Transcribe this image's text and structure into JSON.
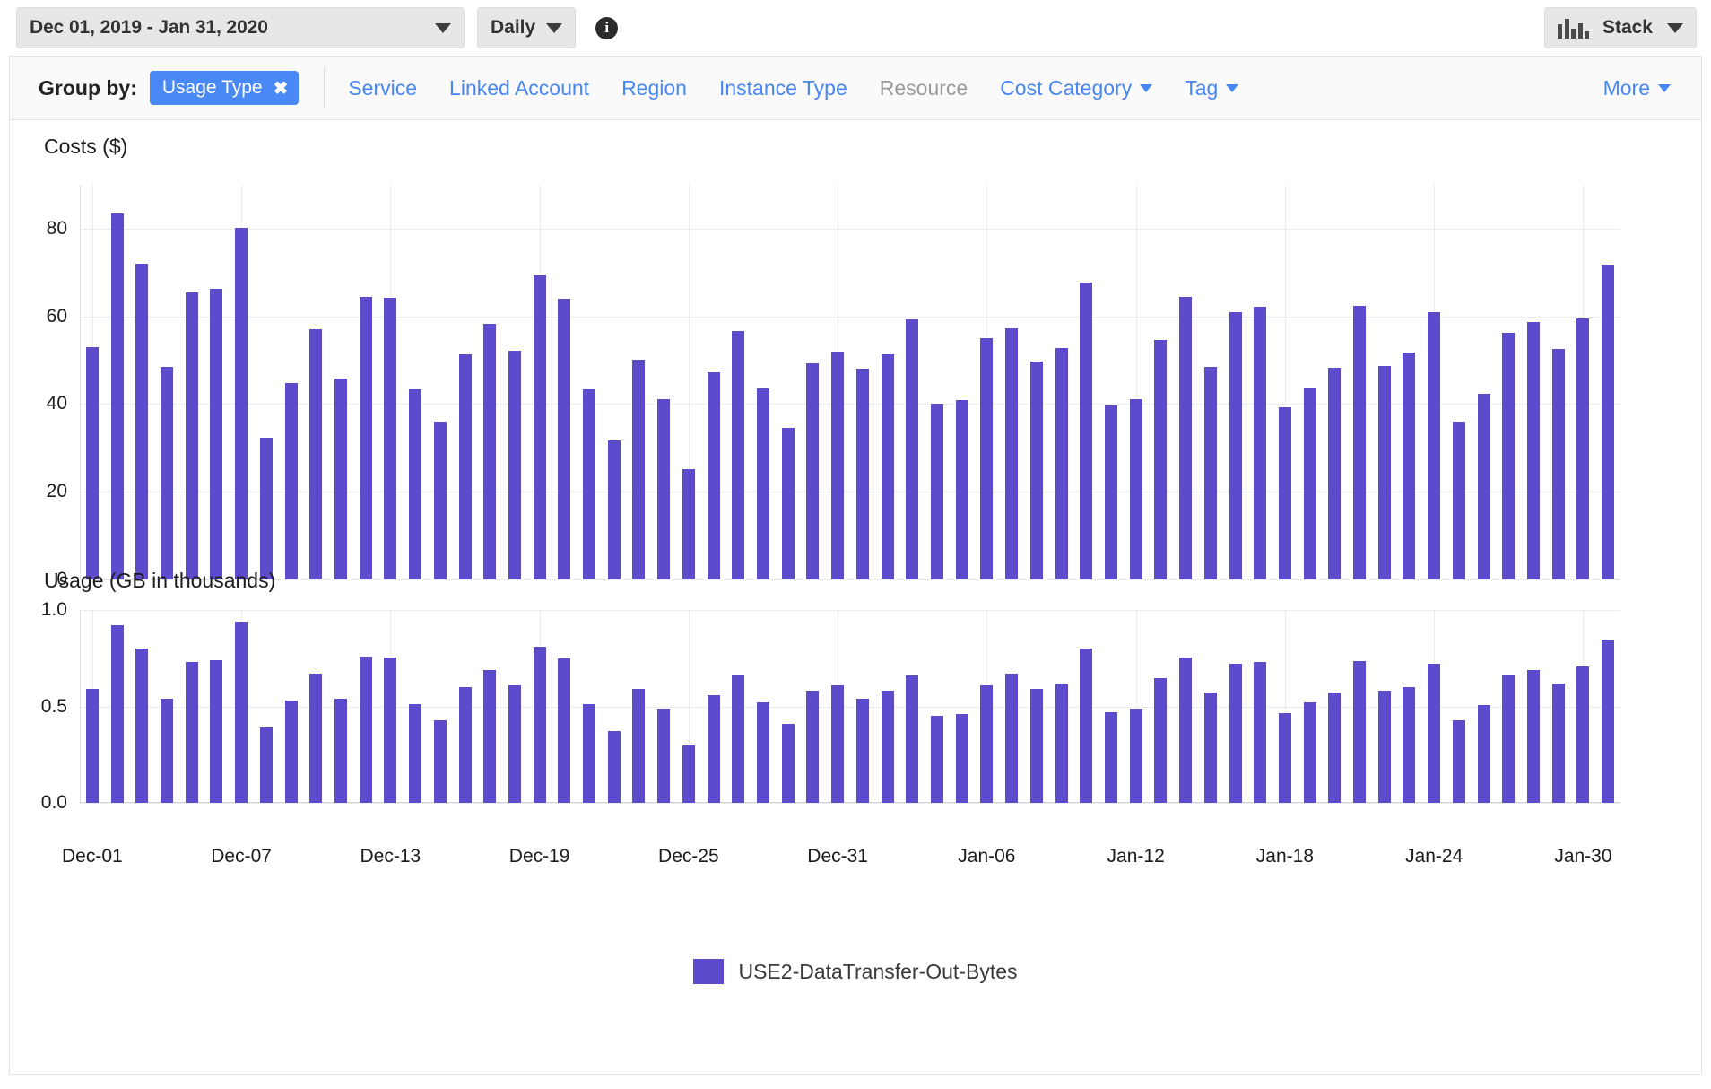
{
  "toolbar": {
    "date_range": "Dec 01, 2019 - Jan 31, 2020",
    "granularity": "Daily",
    "info_icon": "info-icon",
    "stack_label": "Stack",
    "stack_icon": "bar-chart-icon",
    "caret_icon": "chevron-down-icon"
  },
  "group_by": {
    "label": "Group by:",
    "selected_chip": "Usage Type",
    "chip_remove_icon": "close-x-icon",
    "options": [
      {
        "label": "Service",
        "disabled": false,
        "has_caret": false
      },
      {
        "label": "Linked Account",
        "disabled": false,
        "has_caret": false
      },
      {
        "label": "Region",
        "disabled": false,
        "has_caret": false
      },
      {
        "label": "Instance Type",
        "disabled": false,
        "has_caret": false
      },
      {
        "label": "Resource",
        "disabled": true,
        "has_caret": false
      },
      {
        "label": "Cost Category",
        "disabled": false,
        "has_caret": true
      },
      {
        "label": "Tag",
        "disabled": false,
        "has_caret": true
      }
    ],
    "more_label": "More",
    "more_caret": "chevron-down-icon"
  },
  "legend": {
    "series_name": "USE2-DataTransfer-Out-Bytes",
    "color": "#5c4ccc"
  },
  "colors": {
    "bar": "#5c4ccc",
    "link": "#4887f2",
    "chip": "#4989f5",
    "grid": "#ececec",
    "panel_bg": "#fafafa"
  },
  "chart_data": [
    {
      "type": "bar",
      "title": "Costs ($)",
      "xlabel": "",
      "ylabel": "Costs ($)",
      "ylim": [
        0,
        90
      ],
      "yticks": [
        0,
        20,
        40,
        60,
        80
      ],
      "ytick_labels": [
        "0",
        "20",
        "40",
        "60",
        "80"
      ],
      "grid": true,
      "legend_position": "bottom-center",
      "series": [
        {
          "name": "USE2-DataTransfer-Out-Bytes",
          "color": "#5c4ccc",
          "values": [
            53.0,
            83.5,
            72.0,
            48.5,
            65.5,
            66.2,
            80.2,
            32.4,
            44.8,
            57.0,
            45.8,
            64.5,
            64.2,
            43.3,
            36.0,
            51.3,
            58.4,
            52.2,
            69.4,
            64.0,
            43.3,
            31.8,
            50.2,
            41.2,
            25.2,
            47.2,
            56.6,
            43.6,
            34.6,
            49.3,
            52.0,
            48.0,
            51.4,
            59.4,
            40.1,
            41.0,
            55.0,
            57.2,
            49.7,
            52.8,
            67.8,
            39.7,
            41.2,
            54.7,
            64.5,
            48.4,
            61.0,
            62.2,
            39.2,
            43.7,
            48.2,
            62.4,
            48.7,
            51.7,
            60.9,
            36.0,
            42.4,
            56.3,
            58.8,
            52.6,
            59.5,
            71.9
          ]
        }
      ],
      "categories": [
        "Dec-01",
        "Dec-02",
        "Dec-03",
        "Dec-04",
        "Dec-05",
        "Dec-06",
        "Dec-07",
        "Dec-08",
        "Dec-09",
        "Dec-10",
        "Dec-11",
        "Dec-12",
        "Dec-13",
        "Dec-14",
        "Dec-15",
        "Dec-16",
        "Dec-17",
        "Dec-18",
        "Dec-19",
        "Dec-20",
        "Dec-21",
        "Dec-22",
        "Dec-23",
        "Dec-24",
        "Dec-25",
        "Dec-26",
        "Dec-27",
        "Dec-28",
        "Dec-29",
        "Dec-30",
        "Dec-31",
        "Jan-01",
        "Jan-02",
        "Jan-03",
        "Jan-04",
        "Jan-05",
        "Jan-06",
        "Jan-07",
        "Jan-08",
        "Jan-09",
        "Jan-10",
        "Jan-11",
        "Jan-12",
        "Jan-13",
        "Jan-14",
        "Jan-15",
        "Jan-16",
        "Jan-17",
        "Jan-18",
        "Jan-19",
        "Jan-20",
        "Jan-21",
        "Jan-22",
        "Jan-23",
        "Jan-24",
        "Jan-25",
        "Jan-26",
        "Jan-27",
        "Jan-28",
        "Jan-29",
        "Jan-30",
        "Jan-31"
      ],
      "xtick_labels": [
        "Dec-01",
        "Dec-07",
        "Dec-13",
        "Dec-19",
        "Dec-25",
        "Dec-31",
        "Jan-06",
        "Jan-12",
        "Jan-18",
        "Jan-24",
        "Jan-30"
      ],
      "xtick_indices": [
        0,
        6,
        12,
        18,
        24,
        30,
        36,
        42,
        48,
        54,
        60
      ]
    },
    {
      "type": "bar",
      "title": "Usage (GB in thousands)",
      "xlabel": "",
      "ylabel": "Usage (GB in thousands)",
      "ylim": [
        0,
        1.0
      ],
      "yticks": [
        0.0,
        0.5,
        1.0
      ],
      "ytick_labels": [
        "0.0",
        "0.5",
        "1.0"
      ],
      "grid": true,
      "series": [
        {
          "name": "USE2-DataTransfer-Out-Bytes",
          "color": "#5c4ccc",
          "values": [
            0.59,
            0.92,
            0.8,
            0.54,
            0.73,
            0.74,
            0.94,
            0.39,
            0.53,
            0.67,
            0.54,
            0.76,
            0.755,
            0.51,
            0.43,
            0.6,
            0.69,
            0.61,
            0.81,
            0.75,
            0.51,
            0.37,
            0.59,
            0.49,
            0.3,
            0.56,
            0.665,
            0.52,
            0.41,
            0.58,
            0.61,
            0.54,
            0.58,
            0.66,
            0.45,
            0.46,
            0.61,
            0.67,
            0.59,
            0.62,
            0.8,
            0.47,
            0.49,
            0.645,
            0.755,
            0.57,
            0.72,
            0.73,
            0.465,
            0.52,
            0.57,
            0.735,
            0.58,
            0.6,
            0.72,
            0.43,
            0.505,
            0.665,
            0.69,
            0.62,
            0.705,
            0.845
          ]
        }
      ],
      "categories": [
        "Dec-01",
        "Dec-02",
        "Dec-03",
        "Dec-04",
        "Dec-05",
        "Dec-06",
        "Dec-07",
        "Dec-08",
        "Dec-09",
        "Dec-10",
        "Dec-11",
        "Dec-12",
        "Dec-13",
        "Dec-14",
        "Dec-15",
        "Dec-16",
        "Dec-17",
        "Dec-18",
        "Dec-19",
        "Dec-20",
        "Dec-21",
        "Dec-22",
        "Dec-23",
        "Dec-24",
        "Dec-25",
        "Dec-26",
        "Dec-27",
        "Dec-28",
        "Dec-29",
        "Dec-30",
        "Dec-31",
        "Jan-01",
        "Jan-02",
        "Jan-03",
        "Jan-04",
        "Jan-05",
        "Jan-06",
        "Jan-07",
        "Jan-08",
        "Jan-09",
        "Jan-10",
        "Jan-11",
        "Jan-12",
        "Jan-13",
        "Jan-14",
        "Jan-15",
        "Jan-16",
        "Jan-17",
        "Jan-18",
        "Jan-19",
        "Jan-20",
        "Jan-21",
        "Jan-22",
        "Jan-23",
        "Jan-24",
        "Jan-25",
        "Jan-26",
        "Jan-27",
        "Jan-28",
        "Jan-29",
        "Jan-30",
        "Jan-31"
      ],
      "xtick_labels": [
        "Dec-01",
        "Dec-07",
        "Dec-13",
        "Dec-19",
        "Dec-25",
        "Dec-31",
        "Jan-06",
        "Jan-12",
        "Jan-18",
        "Jan-24",
        "Jan-30"
      ],
      "xtick_indices": [
        0,
        6,
        12,
        18,
        24,
        30,
        36,
        42,
        48,
        54,
        60
      ]
    }
  ]
}
